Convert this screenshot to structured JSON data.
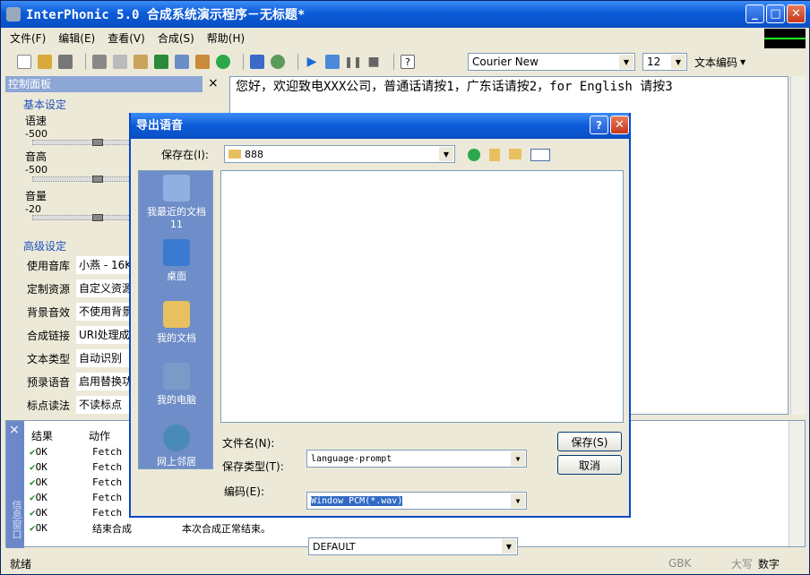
{
  "window": {
    "title": "InterPhonic 5.0 合成系统演示程序－无标题*",
    "min": "_",
    "max": "□",
    "close": "✕"
  },
  "menu": [
    "文件(F)",
    "编辑(E)",
    "查看(V)",
    "合成(S)",
    "帮助(H)"
  ],
  "toolbar": {
    "font": "Courier New",
    "size": "12",
    "encoding": "文本编码"
  },
  "panel": {
    "title": "控制面板",
    "close": "×",
    "basic": "基本设定",
    "speed": "语速",
    "speed_val": "-500",
    "pitch": "音高",
    "pitch_val": "-500",
    "volume": "音量",
    "volume_val": "-20",
    "advanced": "高级设定",
    "props": [
      {
        "k": "使用音库",
        "v": "小燕 - 16K"
      },
      {
        "k": "定制资源",
        "v": "自定义资源"
      },
      {
        "k": "背景音效",
        "v": "不使用背景"
      },
      {
        "k": "合成链接",
        "v": "URI处理成"
      },
      {
        "k": "文本类型",
        "v": "自动识别"
      },
      {
        "k": "预录语音",
        "v": "启用替换功"
      },
      {
        "k": "标点读法",
        "v": "不读标点"
      }
    ]
  },
  "editor": {
    "text": "您好，欢迎致电XXX公司，普通话请按1，广东话请按2，for English 请按3"
  },
  "log": {
    "close": "×",
    "col_result": "结果",
    "col_action": "动作",
    "side_label": "信息窗口",
    "rows": [
      {
        "r": "OK",
        "a": "Fetch",
        "d": ""
      },
      {
        "r": "OK",
        "a": "Fetch",
        "d": ""
      },
      {
        "r": "OK",
        "a": "Fetch",
        "d": ""
      },
      {
        "r": "OK",
        "a": "Fetch",
        "d": ""
      },
      {
        "r": "OK",
        "a": "Fetch",
        "d": ""
      },
      {
        "r": "OK",
        "a": "结束合成",
        "d": "本次合成正常结束。"
      }
    ]
  },
  "status": {
    "text": "就绪",
    "enc": "GBK",
    "caps": "大写",
    "num": "数字"
  },
  "dialog": {
    "title": "导出语音",
    "help": "?",
    "close": "✕",
    "save_in_label": "保存在(I):",
    "save_in": "888",
    "places": [
      "我最近的文档",
      "11",
      "桌面",
      "我的文档",
      "我的电脑",
      "网上邻居"
    ],
    "filename_label": "文件名(N):",
    "filename": "language-prompt",
    "type_label": "保存类型(T):",
    "type": "Window PCM(*.wav)",
    "enc_label": "编码(E):",
    "enc": "DEFAULT",
    "save": "保存(S)",
    "cancel": "取消"
  }
}
